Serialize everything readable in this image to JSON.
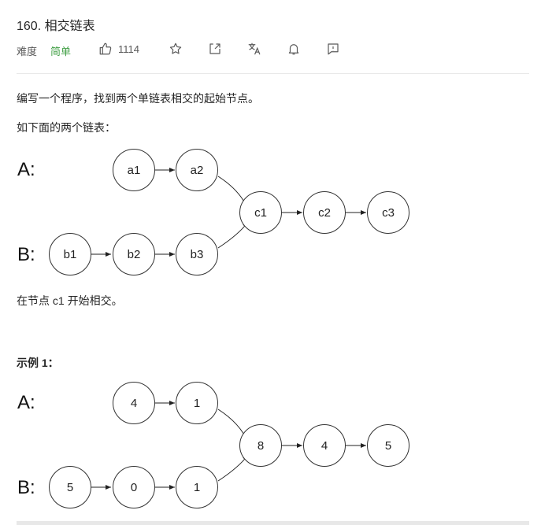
{
  "problem": {
    "title": "160. 相交链表",
    "difficulty_label": "难度",
    "difficulty": "简单",
    "likes": "1114"
  },
  "colors": {
    "easy": "#43a047",
    "text": "#262626",
    "muted": "#595959",
    "divider": "#e8e8e8"
  },
  "toolbar_icons": [
    "thumbs-up-icon",
    "star-icon",
    "share-icon",
    "translate-icon",
    "bell-icon",
    "feedback-icon"
  ],
  "description": {
    "intro": "编写一个程序，找到两个单链表相交的起始节点。",
    "lead": "如下面的两个链表：",
    "note": "在节点 c1 开始相交。",
    "example_title": "示例 1："
  },
  "diagram1": {
    "list_a_label": "A:",
    "list_b_label": "B:",
    "a_nodes": [
      "a1",
      "a2"
    ],
    "b_nodes": [
      "b1",
      "b2",
      "b3"
    ],
    "shared_nodes": [
      "c1",
      "c2",
      "c3"
    ]
  },
  "diagram2": {
    "list_a_label": "A:",
    "list_b_label": "B:",
    "a_nodes": [
      "4",
      "1"
    ],
    "b_nodes": [
      "5",
      "0",
      "1"
    ],
    "shared_nodes": [
      "8",
      "4",
      "5"
    ]
  }
}
